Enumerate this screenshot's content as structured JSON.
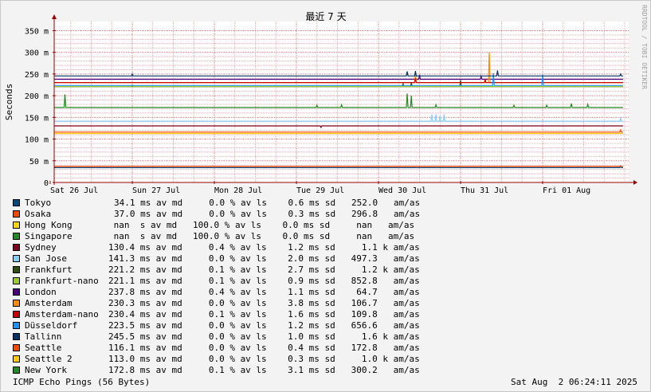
{
  "chart_data": {
    "type": "line",
    "title": "最近 7 天",
    "ylabel": "Seconds",
    "ylim": [
      0,
      360
    ],
    "yticks": [
      {
        "value": 0,
        "label": "0"
      },
      {
        "value": 50,
        "label": "50 m"
      },
      {
        "value": 100,
        "label": "100 m"
      },
      {
        "value": 150,
        "label": "150 m"
      },
      {
        "value": 200,
        "label": "200 m"
      },
      {
        "value": 250,
        "label": "250 m"
      },
      {
        "value": 300,
        "label": "300 m"
      },
      {
        "value": 350,
        "label": "350 m"
      }
    ],
    "xlim": [
      0,
      7
    ],
    "xticks": [
      {
        "value": 0,
        "label": "Sat 26 Jul"
      },
      {
        "value": 1,
        "label": "Sun 27 Jul"
      },
      {
        "value": 2,
        "label": "Mon 28 Jul"
      },
      {
        "value": 3,
        "label": "Tue 29 Jul"
      },
      {
        "value": 4,
        "label": "Wed 30 Jul"
      },
      {
        "value": 5,
        "label": "Thu 31 Jul"
      },
      {
        "value": 6,
        "label": "Fri 01 Aug"
      }
    ],
    "grid": true,
    "legend_position": "bottom",
    "series": [
      {
        "name": "Tokyo",
        "color": "#004a7f",
        "base": 34.1,
        "stats": "34.1 ms av md     0.0 % av ls    0.6 ms sd   252.0   am/as"
      },
      {
        "name": "Osaka",
        "color": "#ff4500",
        "base": 37.0,
        "stats": "37.0 ms av md     0.0 % av ls    0.3 ms sd   296.8   am/as"
      },
      {
        "name": "Hong Kong",
        "color": "#ffd700",
        "base": null,
        "stats": " nan  s av md   100.0 % av ls    0.0 ms sd     nan   am/as"
      },
      {
        "name": "Singapore",
        "color": "#228b22",
        "base": null,
        "stats": " nan  s av md   100.0 % av ls    0.0 ms sd     nan   am/as"
      },
      {
        "name": "Sydney",
        "color": "#800020",
        "base": 130.4,
        "stats": "130.4 ms av md     0.4 % av ls    1.2 ms sd     1.1 k am/as"
      },
      {
        "name": "San Jose",
        "color": "#87cefa",
        "base": 141.3,
        "stats": "141.3 ms av md     0.0 % av ls    2.0 ms sd   497.3   am/as"
      },
      {
        "name": "Frankfurt",
        "color": "#2f4f0f",
        "base": 221.2,
        "stats": "221.2 ms av md     0.1 % av ls    2.7 ms sd     1.2 k am/as"
      },
      {
        "name": "Frankfurt-nano",
        "color": "#9acd32",
        "base": 221.1,
        "stats": "221.1 ms av md     0.1 % av ls    0.9 ms sd   852.8   am/as"
      },
      {
        "name": "London",
        "color": "#4b0082",
        "base": 237.8,
        "stats": "237.8 ms av md     0.4 % av ls    1.1 ms sd    64.7   am/as"
      },
      {
        "name": "Amsterdam",
        "color": "#ff8c00",
        "base": 230.3,
        "stats": "230.3 ms av md     0.0 % av ls    3.8 ms sd   106.7   am/as"
      },
      {
        "name": "Amsterdam-nano",
        "color": "#cc0000",
        "base": 230.4,
        "stats": "230.4 ms av md     0.1 % av ls    1.6 ms sd   109.8   am/as"
      },
      {
        "name": "Düsseldorf",
        "color": "#1e90ff",
        "base": 223.5,
        "stats": "223.5 ms av md     0.0 % av ls    1.2 ms sd   656.6   am/as"
      },
      {
        "name": "Tallinn",
        "color": "#003366",
        "base": 245.5,
        "stats": "245.5 ms av md     0.0 % av ls    1.0 ms sd     1.6 k am/as"
      },
      {
        "name": "Seattle",
        "color": "#ff4500",
        "base": 116.1,
        "stats": "116.1 ms av md     0.0 % av ls    0.4 ms sd   172.8   am/as"
      },
      {
        "name": "Seattle 2",
        "color": "#ffcc00",
        "base": 113.0,
        "stats": "113.0 ms av md     0.0 % av ls    0.3 ms sd     1.0 k am/as"
      },
      {
        "name": "New York",
        "color": "#228b22",
        "base": 172.8,
        "stats": "172.8 ms av md     0.1 % av ls    3.1 ms sd   300.2   am/as"
      }
    ]
  },
  "footer": {
    "left": "ICMP Echo Pings (56 Bytes)",
    "right": "Sat Aug  2 06:24:11 2025"
  },
  "credit": "RRDTOOL / TOBI OETIKER",
  "colors": {
    "background": "#f3f3f3",
    "plot_background": "#ffffff",
    "grid_minor": "#e0b0b0",
    "axis": "#990000"
  }
}
